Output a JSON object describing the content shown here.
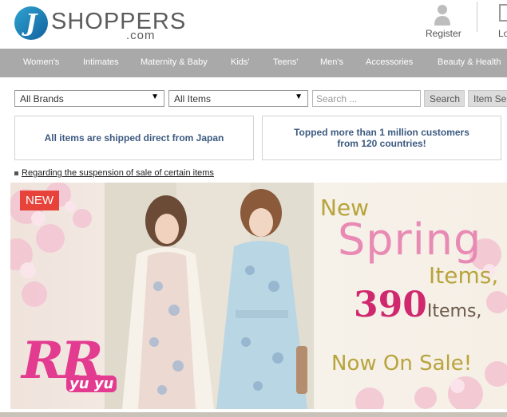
{
  "header": {
    "logo_letter": "J",
    "logo_word": "SHOPPERS",
    "logo_suffix": ".com",
    "register_label": "Register",
    "login_label": "Lo"
  },
  "nav": {
    "items": [
      "Women's",
      "Intimates",
      "Maternity & Baby",
      "Kids'",
      "Teens'",
      "Men's",
      "Accessories",
      "Beauty & Health"
    ]
  },
  "filters": {
    "brand_value": "All Brands",
    "items_value": "All Items",
    "search_placeholder": "Search ...",
    "search_button": "Search",
    "item_search_button": "Item Sea"
  },
  "info": {
    "shipping": "All items are shipped direct from Japan",
    "customers_line1": "Topped more than 1 million customers",
    "customers_line2": "from 120 countries!"
  },
  "notice": {
    "link_text": "Regarding the suspension of sale of certain items"
  },
  "banner": {
    "badge": "NEW",
    "brand_line1": "RR",
    "brand_line2": "yu yu",
    "headline_new": "New",
    "headline_spring": "Spring",
    "headline_items": "Items,",
    "count": "390",
    "count_suffix": "Items,",
    "sale_text": "Now On Sale!"
  },
  "colors": {
    "nav_bg": "#a9a9a9",
    "logo_blue": "#1a75b4",
    "info_text": "#3c5a80",
    "badge_red": "#e8433a",
    "headline_olive": "#b8a43c",
    "headline_pink": "#e88ab4",
    "count_magenta": "#d0286e"
  }
}
